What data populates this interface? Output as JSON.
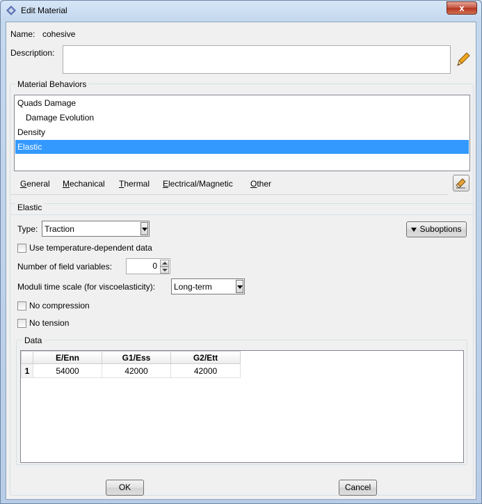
{
  "window": {
    "title": "Edit Material",
    "close_glyph": "x"
  },
  "material": {
    "name_label": "Name:",
    "name_value": "cohesive",
    "description_label": "Description:",
    "description_value": ""
  },
  "behaviors": {
    "group_title": "Material Behaviors",
    "items": [
      {
        "label": "Quads Damage"
      },
      {
        "label": "Damage Evolution"
      },
      {
        "label": "Density"
      },
      {
        "label": "Elastic"
      }
    ],
    "selected_index": 3
  },
  "menu": {
    "items": [
      {
        "first": "G",
        "rest": "eneral"
      },
      {
        "first": "M",
        "rest": "echanical"
      },
      {
        "first": "T",
        "rest": "hermal"
      },
      {
        "first": "E",
        "rest": "lectrical/Magnetic"
      },
      {
        "first": "O",
        "rest": "ther"
      }
    ]
  },
  "elastic": {
    "group_title": "Elastic",
    "type_label": "Type:",
    "type_value": "Traction",
    "suboptions_label": "Suboptions",
    "temp_dependent_label": "Use temperature-dependent data",
    "field_vars_label": "Number of field variables:",
    "field_vars_value": "0",
    "moduli_label": "Moduli time scale (for viscoelasticity):",
    "moduli_value": "Long-term",
    "no_compression_label": "No compression",
    "no_tension_label": "No tension"
  },
  "data_table": {
    "group_title": "Data",
    "headers": [
      "E/Enn",
      "G1/Ess",
      "G2/Ett"
    ],
    "rows": [
      {
        "num": "1",
        "cells": [
          "54000",
          "42000",
          "42000"
        ]
      }
    ]
  },
  "buttons": {
    "ok": "OK",
    "cancel": "Cancel"
  },
  "colors": {
    "selection": "#3399ff",
    "titlebar": "#c4d8ee",
    "close": "#c4523e"
  }
}
